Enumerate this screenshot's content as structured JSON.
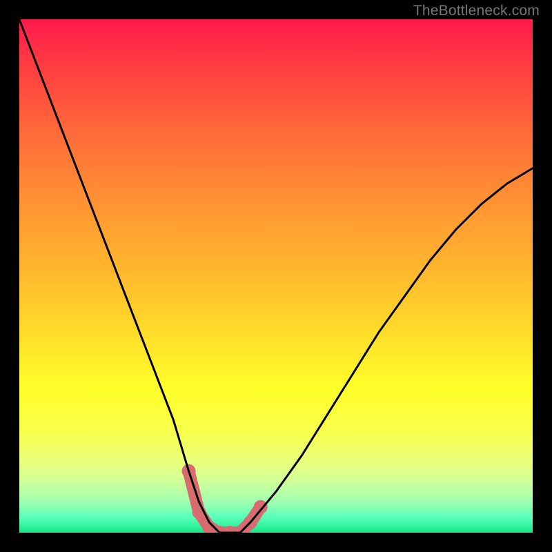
{
  "watermark": "TheBottleneck.com",
  "chart_data": {
    "type": "line",
    "title": "",
    "xlabel": "",
    "ylabel": "",
    "xlim": [
      0,
      100
    ],
    "ylim": [
      0,
      100
    ],
    "series": [
      {
        "name": "curve",
        "x": [
          0,
          5,
          10,
          15,
          20,
          25,
          30,
          33,
          35,
          37,
          39,
          41,
          43,
          45,
          50,
          55,
          60,
          65,
          70,
          75,
          80,
          85,
          90,
          95,
          100
        ],
        "y": [
          100,
          87,
          74,
          61,
          48,
          35,
          22,
          12,
          6,
          2,
          0,
          0,
          0,
          2,
          8,
          15,
          23,
          31,
          39,
          46,
          53,
          59,
          64,
          68,
          71
        ]
      },
      {
        "name": "markers",
        "x": [
          33,
          35,
          37,
          39,
          41,
          43,
          45,
          47
        ],
        "y": [
          12,
          4,
          1,
          0,
          0,
          0,
          2,
          5
        ]
      }
    ],
    "colors": {
      "curve": "#000000",
      "markers": "#d86b6f"
    }
  }
}
